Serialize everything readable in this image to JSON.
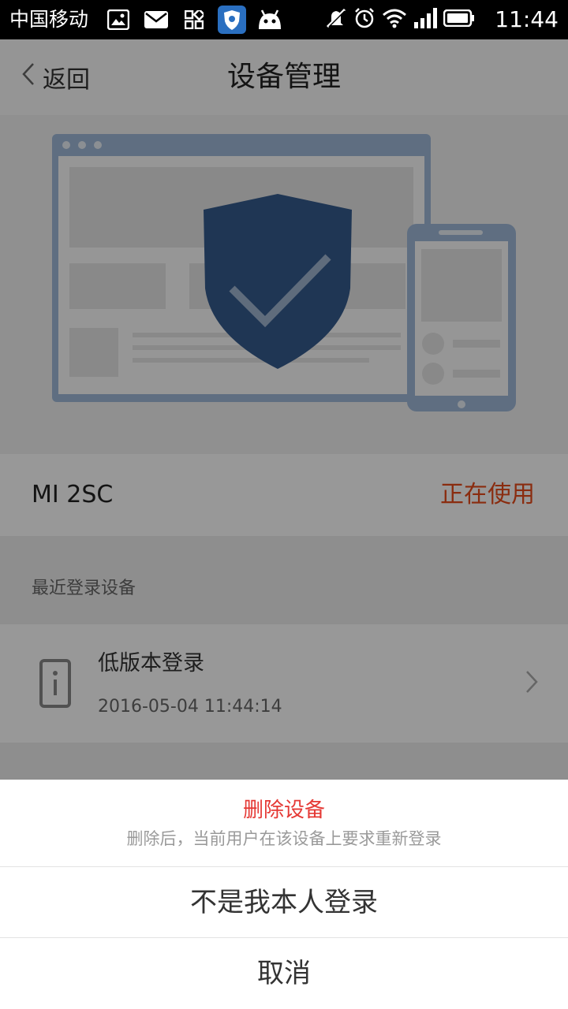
{
  "status_bar": {
    "carrier": "中国移动",
    "time": "11:44",
    "left_icons": [
      "image-icon",
      "mail-icon",
      "app-grid-icon",
      "shield-app-icon",
      "android-icon"
    ],
    "right_icons": [
      "mute-icon",
      "alarm-icon",
      "wifi-icon",
      "signal-icon",
      "battery-icon"
    ]
  },
  "header": {
    "back_label": "返回",
    "title": "设备管理"
  },
  "current_device": {
    "name": "MI 2SC",
    "status": "正在使用"
  },
  "recent": {
    "section_label": "最近登录设备",
    "items": [
      {
        "title": "低版本登录",
        "time": "2016-05-04 11:44:14"
      }
    ]
  },
  "action_sheet": {
    "title": "删除设备",
    "subtitle": "删除后，当前用户在该设备上要求重新登录",
    "options": [
      "不是我本人登录",
      "取消"
    ]
  },
  "colors": {
    "accent_red": "#e53935",
    "status_orange": "#e64a19",
    "shield_blue": "#355a8c"
  }
}
